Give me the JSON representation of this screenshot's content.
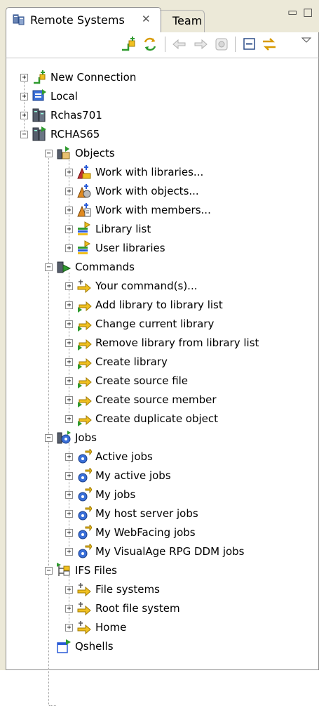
{
  "view": {
    "tabs": [
      {
        "label": "Remote Systems",
        "close": "✕",
        "icon": "remote-systems-icon"
      },
      {
        "label": "Team"
      }
    ],
    "window_controls": {
      "minimize": "▭",
      "maximize": "□"
    },
    "toolbar": {
      "icons": [
        "define-connection-icon",
        "refresh-icon",
        "back-icon",
        "forward-icon",
        "home-icon",
        "collapse-all-icon",
        "link-with-editor-icon",
        "view-menu-icon"
      ]
    }
  },
  "tree": {
    "new_connection": "New Connection",
    "local": "Local",
    "rchas701": "Rchas701",
    "rchas65": "RCHAS65",
    "objects": {
      "label": "Objects",
      "items": [
        "Work with libraries...",
        "Work with objects...",
        "Work with members...",
        "Library list",
        "User libraries"
      ]
    },
    "commands": {
      "label": "Commands",
      "items": [
        "Your command(s)...",
        "Add library to library list",
        "Change current library",
        "Remove library from library list",
        "Create library",
        "Create source file",
        "Create source member",
        "Create duplicate object"
      ]
    },
    "jobs": {
      "label": "Jobs",
      "items": [
        "Active jobs",
        "My active jobs",
        "My jobs",
        "My host server jobs",
        "My WebFacing jobs",
        "My VisualAge RPG DDM jobs"
      ]
    },
    "ifs": {
      "label": "IFS Files",
      "items": [
        "File systems",
        "Root file system",
        "Home"
      ]
    },
    "qshells": "Qshells"
  },
  "colors": {
    "frame": "#ece9d8",
    "border": "#8c8c8c",
    "connector": "#9a9a9a",
    "accent_green": "#2e9a2e",
    "accent_yellow": "#f0c020",
    "accent_blue": "#2a5bd7"
  }
}
